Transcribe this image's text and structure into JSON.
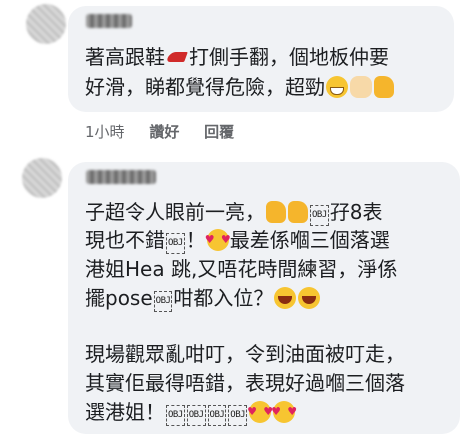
{
  "comment1": {
    "line1_a": "著高跟鞋",
    "heel_icon": "high-heel-icon",
    "line1_b": "打側手翻，個地板仲要",
    "line2": "好滑，睇都覺得危險，超勁",
    "line2_icons": [
      "grin-icon",
      "clap-icon",
      "thumbs-up-icon"
    ],
    "time": "1小時",
    "like_label": "讚好",
    "reply_label": "回覆"
  },
  "comment2": {
    "l1_a": "子超令人眼前一亮，",
    "l1_b": "孖8表",
    "l2_a": "現也不錯",
    "l2_b": "！",
    "l2_c": "最差係嗰三個落選",
    "l3": "港姐Hea 跳,又唔花時間練習，淨係",
    "l4_a": "擺pose",
    "l4_b": "咁都入位？",
    "l5": "現場觀眾亂咁叮，令到油面被叮走，",
    "l6": "其實佢最得唔錯，表現好過嗰三個落",
    "l7": "選港姐！",
    "obj_label": "OBJ"
  }
}
